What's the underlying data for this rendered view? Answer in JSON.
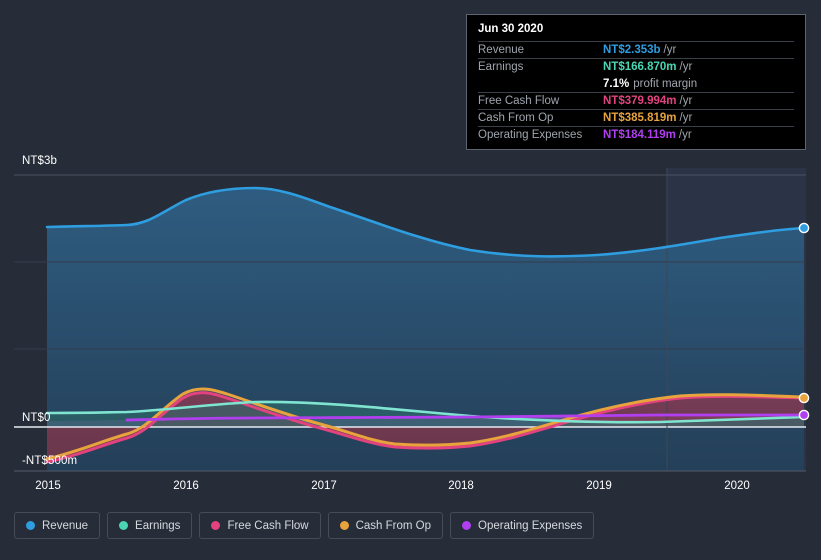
{
  "colors": {
    "background": "#262c38",
    "revenue": "#2e9ee0",
    "earnings": "#4ad6b5",
    "free_cash_flow": "#e2437e",
    "cash_from_op": "#e8a33d",
    "operating_expenses": "#b13ff0",
    "zero_line": "#ffffff",
    "grid": "#3b4250",
    "tooltip_bg": "#000000",
    "tooltip_border": "#5d6370",
    "text": "#ffffff",
    "muted_text": "#a0a5ad"
  },
  "tooltip": {
    "date": "Jun 30 2020",
    "rows": [
      {
        "key": "Revenue",
        "value": "NT$2.353b",
        "unit": "/yr",
        "color": "#2e9ee0"
      },
      {
        "key": "Earnings",
        "value": "NT$166.870m",
        "unit": "/yr",
        "color": "#4ad6b5"
      },
      {
        "key": "Free Cash Flow",
        "value": "NT$379.994m",
        "unit": "/yr",
        "color": "#e2437e"
      },
      {
        "key": "Cash From Op",
        "value": "NT$385.819m",
        "unit": "/yr",
        "color": "#e8a33d"
      },
      {
        "key": "Operating Expenses",
        "value": "NT$184.119m",
        "unit": "/yr",
        "color": "#b13ff0"
      }
    ],
    "profit_margin_value": "7.1%",
    "profit_margin_label": "profit margin"
  },
  "legend": {
    "items": [
      {
        "label": "Revenue",
        "color": "#2e9ee0"
      },
      {
        "label": "Earnings",
        "color": "#4ad6b5"
      },
      {
        "label": "Free Cash Flow",
        "color": "#e2437e"
      },
      {
        "label": "Cash From Op",
        "color": "#e8a33d"
      },
      {
        "label": "Operating Expenses",
        "color": "#b13ff0"
      }
    ]
  },
  "axes": {
    "y_top_label": "NT$3b",
    "y_zero_label": "NT$0",
    "y_bottom_label": "-NT$500m",
    "x_ticks": [
      "2015",
      "2016",
      "2017",
      "2018",
      "2019",
      "2020"
    ]
  },
  "chart_data": {
    "type": "area",
    "title": "",
    "subtitle": "",
    "xlabel": "",
    "ylabel": "",
    "currency": "NT$",
    "grid": true,
    "legend_position": "bottom",
    "ylim": [
      -500000000,
      3000000000
    ],
    "y_ticks": [
      3000000000,
      0,
      -500000000
    ],
    "y_tick_labels": [
      "NT$3b",
      "NT$0",
      "-NT$500m"
    ],
    "xlim": [
      "2015-01-01",
      "2020-06-30"
    ],
    "x_tick_labels": [
      "2015",
      "2016",
      "2017",
      "2018",
      "2019",
      "2020"
    ],
    "x": [
      "2015.0",
      "2015.5",
      "2016.0",
      "2016.5",
      "2017.0",
      "2017.5",
      "2018.0",
      "2018.5",
      "2019.0",
      "2019.5",
      "2020.0",
      "2020.5"
    ],
    "forecast_region_starts": "2019.75",
    "highlighted_point": "2020.5",
    "series": [
      {
        "name": "Revenue",
        "color": "#2e9ee0",
        "unit": "NT$",
        "filled": true,
        "endpoint_marker": true,
        "values": [
          2.33,
          2.35,
          2.62,
          2.82,
          2.72,
          2.57,
          2.4,
          2.26,
          2.17,
          2.18,
          2.25,
          2.353
        ],
        "value_unit": "b",
        "last_value_label": "NT$2.353b"
      },
      {
        "name": "Earnings",
        "color": "#4ad6b5",
        "unit": "NT$",
        "filled": true,
        "endpoint_marker": false,
        "values": [
          0.06,
          0.075,
          0.11,
          0.125,
          0.105,
          0.08,
          0.055,
          0.045,
          0.055,
          0.085,
          0.125,
          0.167
        ],
        "value_unit": "b",
        "last_value_label": "NT$166.870m"
      },
      {
        "name": "Free Cash Flow",
        "color": "#e2437e",
        "unit": "NT$",
        "filled": true,
        "endpoint_marker": true,
        "values": [
          -0.5,
          -0.33,
          0.24,
          0.185,
          0.01,
          -0.16,
          -0.195,
          -0.175,
          -0.04,
          0.19,
          0.33,
          0.38
        ],
        "value_unit": "b",
        "last_value_label": "NT$379.994m"
      },
      {
        "name": "Cash From Op",
        "color": "#e8a33d",
        "unit": "NT$",
        "filled": true,
        "endpoint_marker": true,
        "values": [
          -0.49,
          -0.315,
          0.26,
          0.2,
          0.025,
          -0.145,
          -0.185,
          -0.16,
          -0.02,
          0.215,
          0.36,
          0.386
        ],
        "value_unit": "b",
        "last_value_label": "NT$385.819m"
      },
      {
        "name": "Operating Expenses",
        "color": "#b13ff0",
        "unit": "NT$",
        "filled": true,
        "endpoint_marker": true,
        "values": [
          0.14,
          0.142,
          0.15,
          0.155,
          0.158,
          0.16,
          0.162,
          0.163,
          0.168,
          0.172,
          0.178,
          0.184
        ],
        "value_unit": "b",
        "last_value_label": "NT$184.119m"
      }
    ]
  }
}
